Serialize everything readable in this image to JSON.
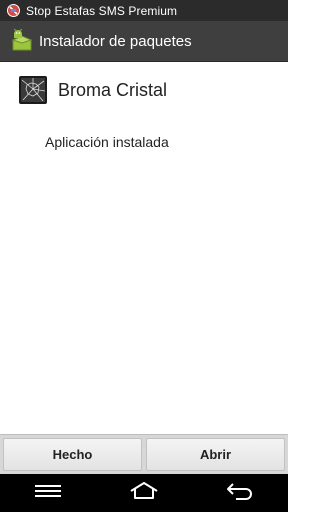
{
  "status_bar": {
    "notification_icon": "stop-sign-icon",
    "text": "Stop Estafas SMS Premium"
  },
  "action_bar": {
    "icon": "android-package-icon",
    "title": "Instalador de paquetes"
  },
  "app": {
    "icon": "cracked-glass-icon",
    "name": "Broma Cristal"
  },
  "install_status": "Aplicación instalada",
  "buttons": {
    "done": "Hecho",
    "open": "Abrir"
  },
  "nav": {
    "menu_icon": "menu-icon",
    "home_icon": "home-icon",
    "back_icon": "back-icon"
  },
  "colors": {
    "status_bar_bg": "#2b2b2b",
    "action_bar_bg": "#3f3f3f",
    "android_green": "#9bc53d",
    "button_bar_bg": "#d7d7d7"
  }
}
